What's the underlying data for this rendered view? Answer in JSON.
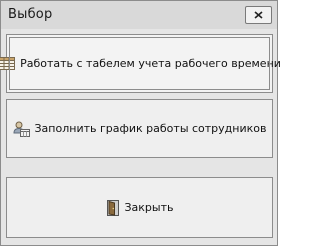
{
  "window": {
    "title": "Выбор",
    "close_icon": "close-icon"
  },
  "buttons": [
    {
      "label": "Работать с табелем учета рабочего времени",
      "icon": "timesheet-grid-icon"
    },
    {
      "label": "Заполнить график работы сотрудников",
      "icon": "employee-schedule-icon"
    },
    {
      "label": "Закрыть",
      "icon": "exit-door-icon"
    }
  ]
}
